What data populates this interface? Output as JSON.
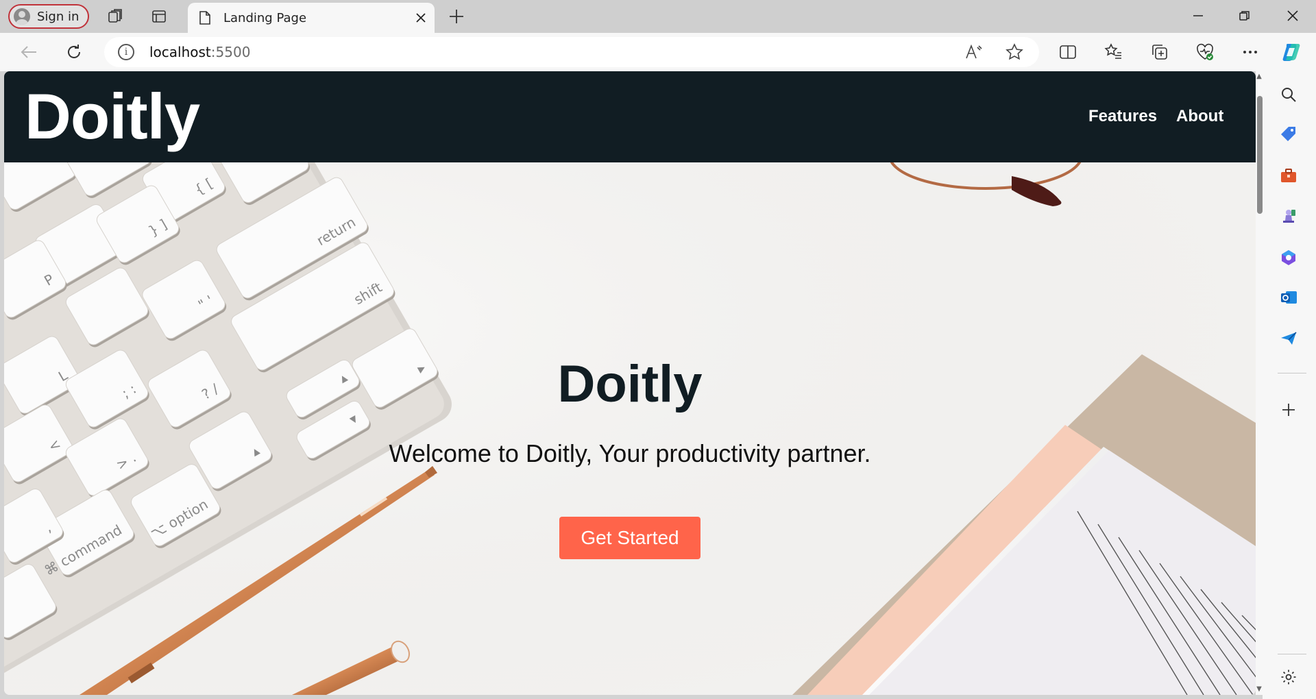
{
  "browser": {
    "signin_label": "Sign in",
    "tab_title": "Landing Page",
    "address": {
      "host": "localhost",
      "port": ":5500"
    }
  },
  "site": {
    "logo": "Doitly",
    "nav": [
      "Features",
      "About"
    ],
    "hero": {
      "title": "Doitly",
      "subtitle": "Welcome to Doitly, Your productivity partner.",
      "cta_label": "Get Started"
    },
    "keycaps": [
      "return",
      "shift",
      "command",
      "option",
      "P",
      "L",
      "?",
      "/",
      "\"",
      "'",
      "{",
      "[",
      "}",
      "]",
      ">",
      "<",
      ";",
      ":",
      ".",
      ",",
      "⌘",
      "⌥"
    ]
  },
  "colors": {
    "nav_bg": "#111d23",
    "cta_bg": "#ff644a",
    "signin_border": "#c0323a"
  }
}
